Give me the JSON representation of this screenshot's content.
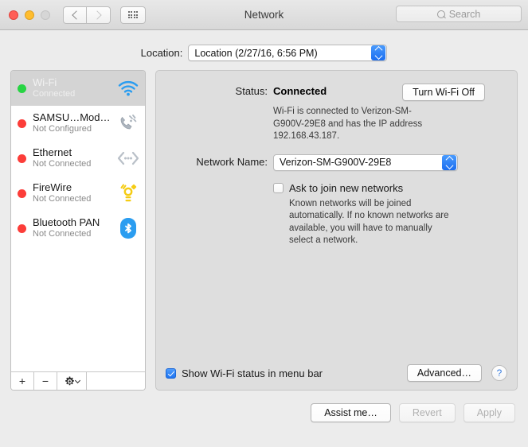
{
  "window": {
    "title": "Network",
    "traffic_lights": [
      "close",
      "minimize",
      "zoom"
    ],
    "nav_back_icon": "chevron-left-icon",
    "nav_forward_icon": "chevron-right-icon",
    "show_all_icon": "grid-icon"
  },
  "search": {
    "placeholder": "Search",
    "icon": "search-icon"
  },
  "location": {
    "label": "Location:",
    "value": "Location (2/27/16, 6:56 PM)"
  },
  "sidebar": {
    "interfaces": [
      {
        "name": "Wi-Fi",
        "status": "Connected",
        "dot": "green",
        "icon": "wifi-icon",
        "selected": true
      },
      {
        "name": "SAMSU…Modem",
        "status": "Not Configured",
        "dot": "red",
        "icon": "modem-icon",
        "selected": false
      },
      {
        "name": "Ethernet",
        "status": "Not Connected",
        "dot": "red",
        "icon": "ethernet-icon",
        "selected": false
      },
      {
        "name": "FireWire",
        "status": "Not Connected",
        "dot": "red",
        "icon": "firewire-icon",
        "selected": false
      },
      {
        "name": "Bluetooth PAN",
        "status": "Not Connected",
        "dot": "red",
        "icon": "bluetooth-icon",
        "selected": false
      }
    ],
    "toolbar": {
      "add_label": "+",
      "remove_label": "−",
      "gear_icon": "gear-icon"
    }
  },
  "main": {
    "status_label": "Status:",
    "status_value": "Connected",
    "turn_off_button": "Turn Wi-Fi Off",
    "status_description": "Wi-Fi is connected to Verizon-SM-G900V-29E8 and has the IP address 192.168.43.187.",
    "network_name_label": "Network Name:",
    "network_name_value": "Verizon-SM-G900V-29E8",
    "ask_join_label": "Ask to join new networks",
    "ask_join_checked": false,
    "ask_join_description": "Known networks will be joined automatically. If no known networks are available, you will have to manually select a network.",
    "show_status_label": "Show Wi-Fi status in menu bar",
    "show_status_checked": true,
    "advanced_button": "Advanced…",
    "help_button": "?"
  },
  "footer": {
    "assist_button": "Assist me…",
    "revert_button": "Revert",
    "apply_button": "Apply",
    "revert_enabled": false,
    "apply_enabled": false
  },
  "colors": {
    "accent_blue": "#1f74f0",
    "connected_green": "#27d443",
    "disconnected_red": "#fc3d39",
    "window_bg": "#ececec",
    "panel_bg": "#dedede"
  }
}
